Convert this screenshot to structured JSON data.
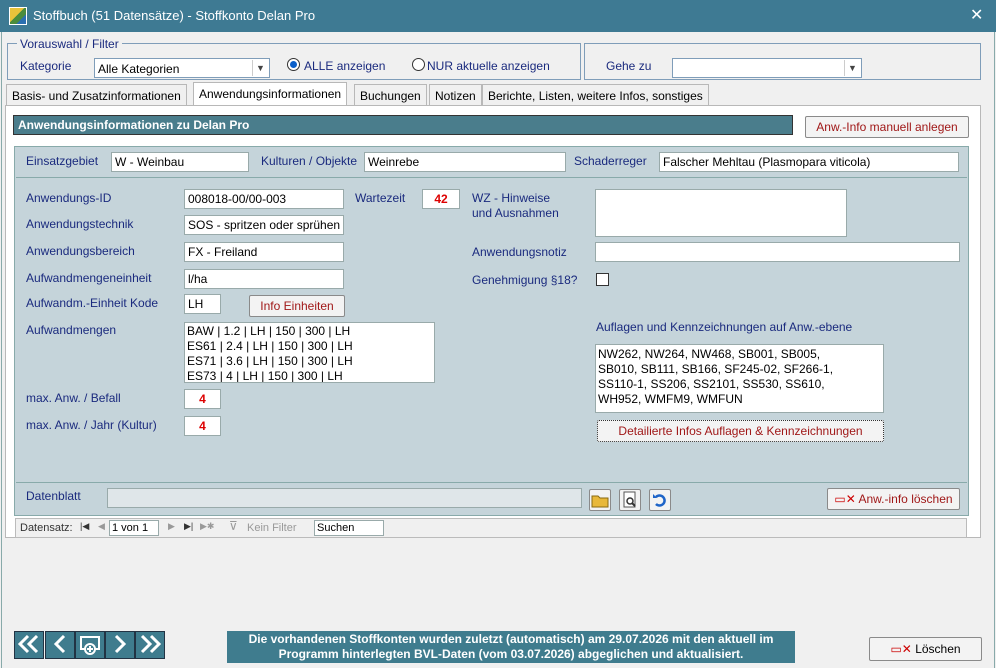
{
  "window": {
    "title": "Stoffbuch (51 Datensätze) - Stoffkonto Delan Pro"
  },
  "filter": {
    "legend": "Vorauswahl / Filter",
    "kategorie_label": "Kategorie",
    "kategorie_value": "Alle Kategorien",
    "radio_all": "ALLE anzeigen",
    "radio_current": "NUR aktuelle anzeigen",
    "goto_label": "Gehe zu",
    "goto_value": ""
  },
  "tabs": [
    {
      "label": "Basis- und Zusatzinformationen"
    },
    {
      "label": "Anwendungsinformationen",
      "active": true
    },
    {
      "label": "Buchungen"
    },
    {
      "label": "Notizen"
    },
    {
      "label": "Berichte, Listen, weitere Infos, sonstiges"
    }
  ],
  "section": {
    "header": "Anwendungsinformationen zu Delan Pro",
    "add_button": "Anw.-Info manuell anlegen"
  },
  "top_row": {
    "einsatzgebiet_label": "Einsatzgebiet",
    "einsatzgebiet_value": "W - Weinbau",
    "kulturen_label": "Kulturen / Objekte",
    "kulturen_value": "Weinrebe",
    "schaderreger_label": "Schaderreger",
    "schaderreger_value": "Falscher Mehltau (Plasmopara viticola)"
  },
  "fields": {
    "anwendungs_id_label": "Anwendungs-ID",
    "anwendungs_id_value": "008018-00/00-003",
    "wartezeit_label": "Wartezeit",
    "wartezeit_value": "42",
    "wz_label_1": "WZ - Hinweise",
    "wz_label_2": "und Ausnahmen",
    "wz_value": "",
    "technik_label": "Anwendungstechnik",
    "technik_value": "SOS - spritzen oder sprühen",
    "bereich_label": "Anwendungsbereich",
    "bereich_value": "FX - Freiland",
    "notiz_label": "Anwendungsnotiz",
    "notiz_value": "",
    "einheit_label": "Aufwandmengeneinheit",
    "einheit_value": "l/ha",
    "genehmigung_label": "Genehmigung §18?",
    "kode_label": "Aufwandm.-Einheit Kode",
    "kode_value": "LH",
    "info_einheiten_button": "Info Einheiten",
    "aufwandmengen_label": "Aufwandmengen",
    "aufwandmengen": [
      "BAW | 1.2 | LH | 150 | 300 | LH",
      "ES61 | 2.4 | LH | 150 | 300 | LH",
      "ES71 | 3.6 | LH | 150 | 300 | LH",
      "ES73 | 4 | LH | 150 | 300 | LH"
    ],
    "auflagen_label": "Auflagen und Kennzeichnungen auf Anw.-ebene",
    "auflagen_lines": [
      "NW262, NW264, NW468, SB001, SB005,",
      "SB010, SB111, SB166, SF245-02, SF266-1,",
      "SS110-1, SS206, SS2101, SS530, SS610,",
      "WH952, WMFM9, WMFUN"
    ],
    "auflagen_button": "Detailierte Infos Auflagen & Kennzeichnungen",
    "max_befall_label": "max. Anw. / Befall",
    "max_befall_value": "4",
    "max_jahr_label": "max. Anw. / Jahr (Kultur)",
    "max_jahr_value": "4"
  },
  "datenblatt": {
    "label": "Datenblatt",
    "value": "",
    "delete_button": "Anw.-info löschen"
  },
  "record_nav": {
    "label": "Datensatz:",
    "position": "1 von 1",
    "filter": "Kein Filter",
    "search": "Suchen"
  },
  "footer": {
    "status_line_1": "Die vorhandenen Stoffkonten wurden zuletzt (automatisch) am 29.07.2026 mit den aktuell im",
    "status_line_2": "Programm hinterlegten BVL-Daten (vom 03.07.2026) abgeglichen und aktualisiert.",
    "delete_button": "Löschen"
  },
  "colors": {
    "titlebar": "#3e7a93",
    "header_bar": "#4a7d8c",
    "inner_panel": "#c5d4da",
    "label_blue": "#1a2a7e",
    "value_red": "#dd0000"
  }
}
